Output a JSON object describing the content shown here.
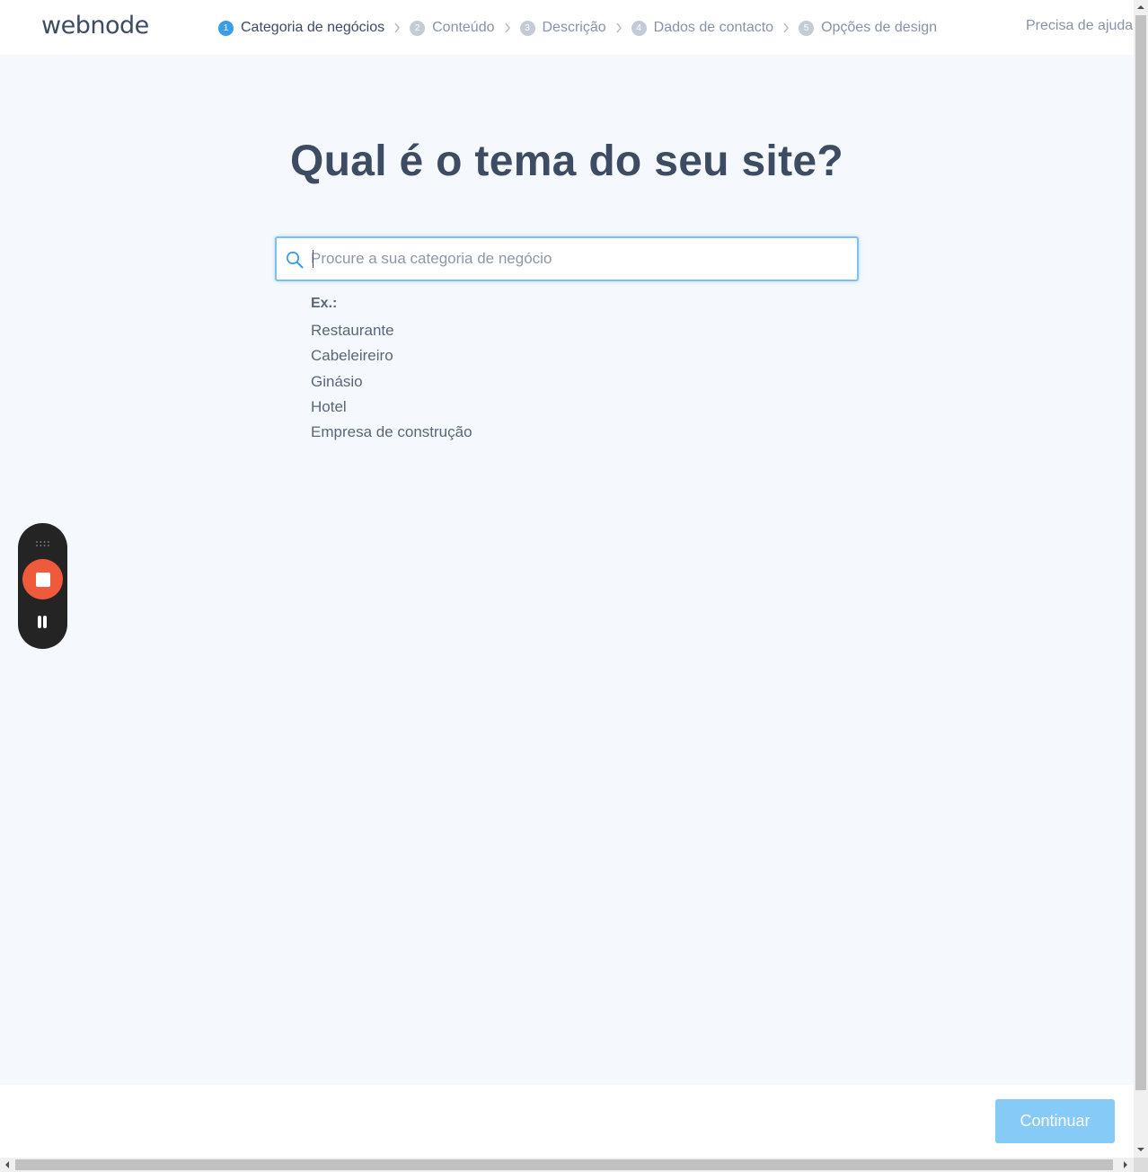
{
  "header": {
    "logo": "webnode",
    "steps": [
      {
        "num": "1",
        "label": "Categoria de negócios",
        "active": true
      },
      {
        "num": "2",
        "label": "Conteúdo",
        "active": false
      },
      {
        "num": "3",
        "label": "Descrição",
        "active": false
      },
      {
        "num": "4",
        "label": "Dados de contacto",
        "active": false
      },
      {
        "num": "5",
        "label": "Opções de design",
        "active": false
      }
    ],
    "help_link": "Precisa de ajuda?"
  },
  "main": {
    "title": "Qual é o tema do seu site?",
    "search": {
      "placeholder": "Procure a sua categoria de negócio",
      "value": ""
    },
    "examples": {
      "label": "Ex.:",
      "items": [
        "Restaurante",
        "Cabeleireiro",
        "Ginásio",
        "Hotel",
        "Empresa de construção"
      ]
    }
  },
  "recorder": {
    "icons": [
      "drag-handle-icon",
      "stop-icon",
      "pause-icon"
    ]
  },
  "footer": {
    "continue_label": "Continuar"
  },
  "colors": {
    "accent": "#3a9ee4",
    "button_disabled": "#86cbf7",
    "page_background": "#f5f9fd",
    "heading": "#3d4b63",
    "record_stop": "#f05a3c"
  }
}
